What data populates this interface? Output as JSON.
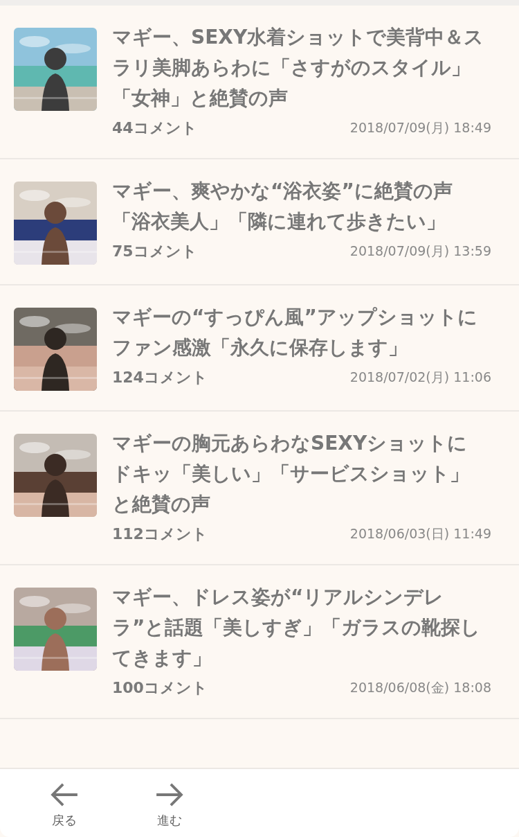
{
  "articles": [
    {
      "title": "マギー、SEXY水着ショットで美背中＆スラリ美脚あらわに「さすがのスタイル」「女神」と絶賛の声",
      "comments": "44コメント",
      "date": "2018/07/09(月) 18:49"
    },
    {
      "title": "マギー、爽やかな“浴衣姿”に絶賛の声「浴衣美人」「隣に連れて歩きたい」",
      "comments": "75コメント",
      "date": "2018/07/09(月) 13:59"
    },
    {
      "title": "マギーの“すっぴん風”アップショットにファン感激「永久に保存します」",
      "comments": "124コメント",
      "date": "2018/07/02(月) 11:06"
    },
    {
      "title": "マギーの胸元あらわなSEXYショットにドキッ「美しい」「サービスショット」と絶賛の声",
      "comments": "112コメント",
      "date": "2018/06/03(日) 11:49"
    },
    {
      "title": "マギー、ドレス姿が“リアルシンデレラ”と話題「美しすぎ」「ガラスの靴探してきます」",
      "comments": "100コメント",
      "date": "2018/06/08(金) 18:08"
    }
  ],
  "nav": {
    "back": "戻る",
    "forward": "進む"
  }
}
